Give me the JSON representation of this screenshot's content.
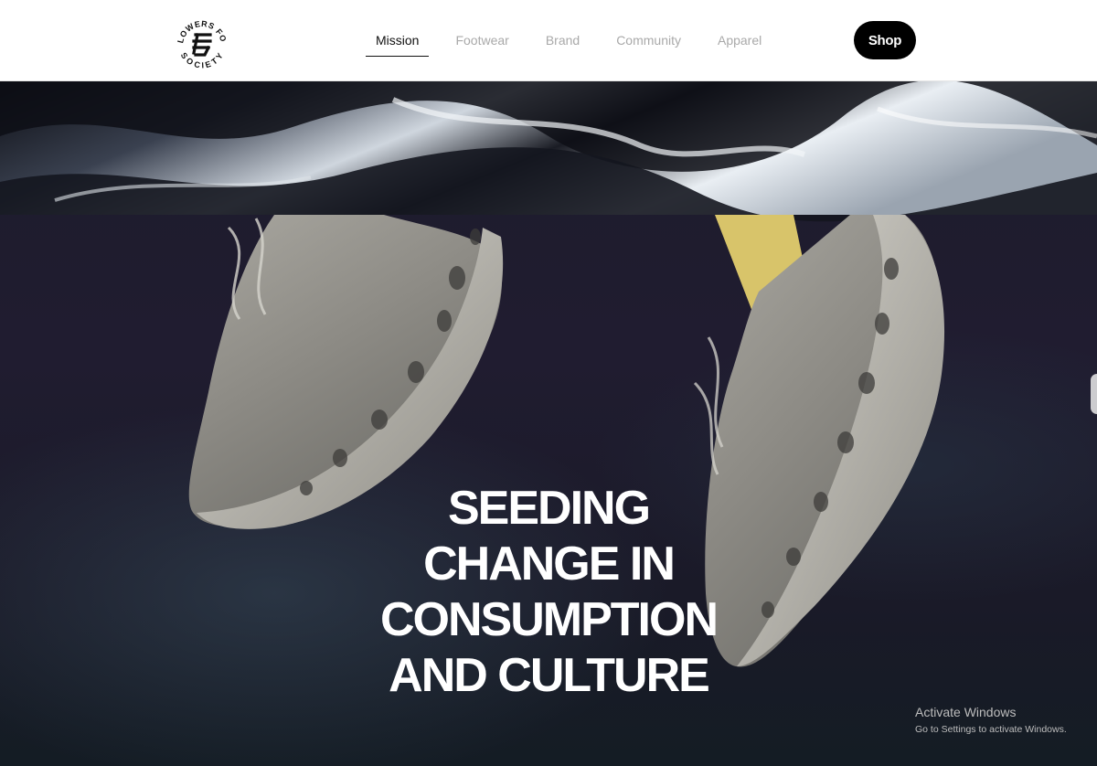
{
  "header": {
    "logo": {
      "text_top": "FLOWERS FOR",
      "text_bottom": "SOCIETY",
      "icon": "ffs-monogram-icon"
    },
    "nav": [
      {
        "label": "Mission",
        "active": true
      },
      {
        "label": "Footwear",
        "active": false
      },
      {
        "label": "Brand",
        "active": false
      },
      {
        "label": "Community",
        "active": false
      },
      {
        "label": "Apparel",
        "active": false
      }
    ],
    "shop_label": "Shop"
  },
  "hero": {
    "headline_lines": [
      "SEEDING",
      "CHANGE IN",
      "CONSUMPTION",
      "AND CULTURE"
    ]
  },
  "watermark": {
    "title": "Activate Windows",
    "subtitle": "Go to Settings to activate Windows."
  },
  "colors": {
    "header_bg": "#ffffff",
    "nav_inactive": "#a9a9a9",
    "nav_active": "#111111",
    "shop_bg": "#000000",
    "hero_bg": "#1d1b2c"
  }
}
